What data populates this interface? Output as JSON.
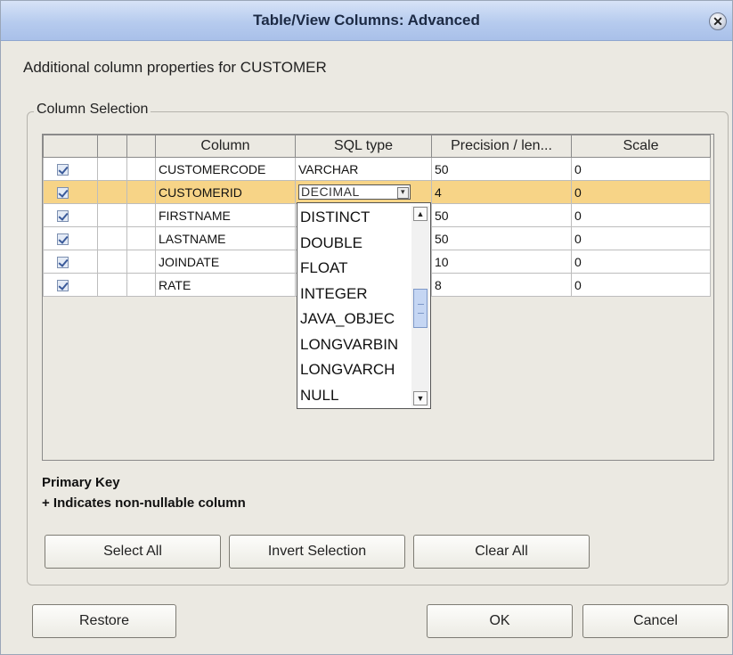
{
  "window": {
    "title": "Table/View Columns: Advanced",
    "close_glyph": "✕"
  },
  "description": "Additional column properties for CUSTOMER",
  "group_label": "Column Selection",
  "table": {
    "headers": [
      "",
      "",
      "",
      "Column",
      "SQL type",
      "Precision / len...",
      "Scale"
    ],
    "rows": [
      {
        "checked": true,
        "column": "CUSTOMERCODE",
        "sql_type": "VARCHAR",
        "precision": "50",
        "scale": "0"
      },
      {
        "checked": true,
        "column": "CUSTOMERID",
        "sql_type": "DECIMAL",
        "precision": "4",
        "scale": "0"
      },
      {
        "checked": true,
        "column": "FIRSTNAME",
        "sql_type": "",
        "precision": "50",
        "scale": "0"
      },
      {
        "checked": true,
        "column": "LASTNAME",
        "sql_type": "",
        "precision": "50",
        "scale": "0"
      },
      {
        "checked": true,
        "column": "JOINDATE",
        "sql_type": "",
        "precision": "10",
        "scale": "0"
      },
      {
        "checked": true,
        "column": "RATE",
        "sql_type": "",
        "precision": "8",
        "scale": "0"
      }
    ]
  },
  "sql_type_dropdown": {
    "options": [
      "DISTINCT",
      "DOUBLE",
      "FLOAT",
      "INTEGER",
      "JAVA_OBJEC",
      "LONGVARBIN",
      "LONGVARCH",
      "NULL"
    ]
  },
  "legend": {
    "primary_key": "Primary Key",
    "non_nullable": "+ Indicates non-nullable column"
  },
  "buttons": {
    "select_all": "Select All",
    "invert_selection": "Invert Selection",
    "clear_all": "Clear All",
    "restore": "Restore",
    "ok": "OK",
    "cancel": "Cancel"
  },
  "colors": {
    "selected_row": "#f7d487",
    "titlebar": "#b6cbee",
    "dialog_bg": "#ebe9e2"
  },
  "icons": {
    "close": "close-icon",
    "checkbox": "checkbox-checked-icon",
    "dropdown": "dropdown-arrow-icon"
  }
}
